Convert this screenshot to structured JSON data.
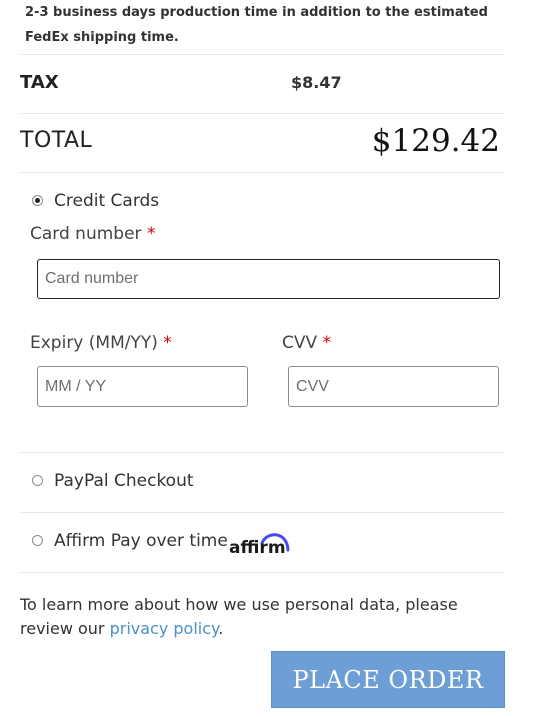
{
  "shipping_note": "2-3 business days production time in addition to the estimated FedEx shipping time.",
  "tax": {
    "label": "TAX",
    "value": "$8.47"
  },
  "total": {
    "label": "TOTAL",
    "value": "$129.42"
  },
  "payment_methods": {
    "credit_cards": {
      "label": "Credit Cards",
      "selected": true,
      "card_number": {
        "label": "Card number",
        "required": "*",
        "placeholder": "Card number",
        "value": ""
      },
      "expiry": {
        "label": "Expiry (MM/YY)",
        "required": "*",
        "placeholder": "MM / YY",
        "value": ""
      },
      "cvv": {
        "label": "CVV",
        "required": "*",
        "placeholder": "CVV",
        "value": ""
      }
    },
    "paypal": {
      "label": "PayPal Checkout",
      "selected": false
    },
    "affirm": {
      "label": "Affirm Pay over time",
      "selected": false,
      "logo_text": "affirm"
    }
  },
  "privacy": {
    "text_before": "To learn more about how we use personal data, please review our ",
    "link_text": "privacy policy",
    "text_after": "."
  },
  "place_order_label": "PLACE ORDER",
  "colors": {
    "button_bg": "#6d9fd6",
    "link": "#4a90c9",
    "required": "#cc0000",
    "affirm_logo": "#1a1a1a",
    "affirm_arc": "#4a4af4"
  }
}
